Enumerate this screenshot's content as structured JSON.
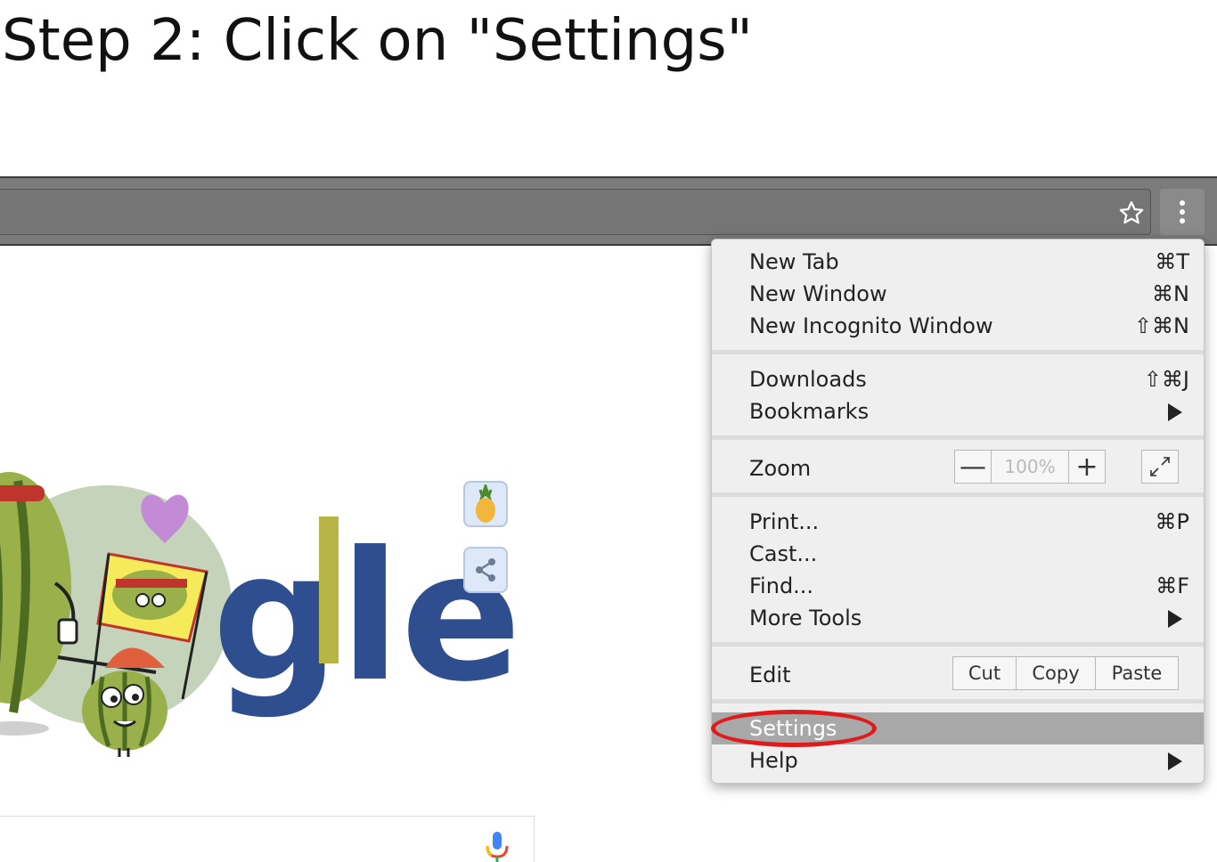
{
  "step_title": "Step 2: Click on \"Settings\"",
  "toolbar": {
    "bookmark_icon": "star-icon",
    "menu_icon": "vertical-dots-icon"
  },
  "doodle": {
    "letters": "gle"
  },
  "menu": {
    "new_tab": {
      "label": "New Tab",
      "shortcut": "⌘T"
    },
    "new_window": {
      "label": "New Window",
      "shortcut": "⌘N"
    },
    "new_incognito": {
      "label": "New Incognito Window",
      "shortcut": "⇧⌘N"
    },
    "downloads": {
      "label": "Downloads",
      "shortcut": "⇧⌘J"
    },
    "bookmarks": {
      "label": "Bookmarks"
    },
    "zoom": {
      "label": "Zoom",
      "minus": "—",
      "value": "100%",
      "plus": "+"
    },
    "print": {
      "label": "Print...",
      "shortcut": "⌘P"
    },
    "cast": {
      "label": "Cast..."
    },
    "find": {
      "label": "Find...",
      "shortcut": "⌘F"
    },
    "more_tools": {
      "label": "More Tools"
    },
    "edit": {
      "label": "Edit",
      "cut": "Cut",
      "copy": "Copy",
      "paste": "Paste"
    },
    "settings": {
      "label": "Settings"
    },
    "help": {
      "label": "Help"
    }
  },
  "annotation": {
    "highlight_color": "#e01b1b"
  }
}
